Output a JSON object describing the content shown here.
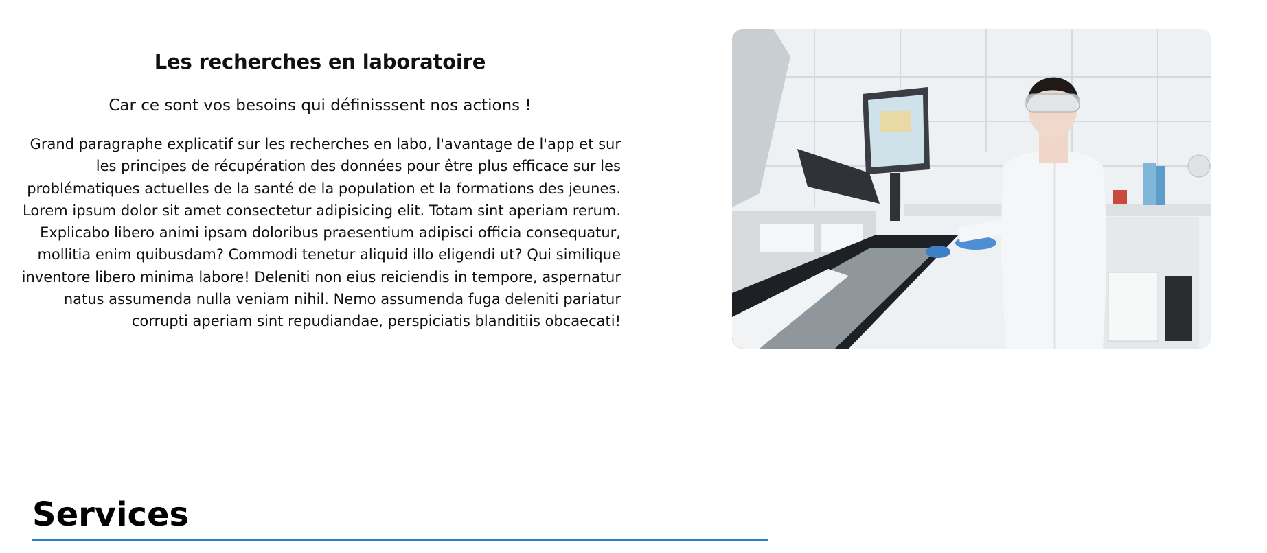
{
  "lab_section": {
    "title": "Les recherches en laboratoire",
    "subtitle": "Car ce sont vos besoins qui définisssent nos actions !",
    "paragraph": "Grand paragraphe explicatif sur les recherches en labo, l'avantage de l'app et sur les principes de récupération des données pour être plus efficace sur les problématiques actuelles de la santé de la population et la formations des jeunes. Lorem ipsum dolor sit amet consectetur adipisicing elit. Totam sint aperiam rerum. Explicabo libero animi ipsam doloribus praesentium adipisci officia consequatur, mollitia enim quibusdam? Commodi tenetur aliquid illo eligendi ut? Qui similique inventore libero minima labore! Deleniti non eius reiciendis in tempore, aspernatur natus assumenda nulla veniam nihil. Nemo assumenda fuga deleniti pariatur corrupti aperiam sint repudiandae, perspiciatis blanditiis obcaecati!",
    "image_icon": "lab-scientist-photo"
  },
  "services": {
    "title": "Services",
    "underline_color": "#2d7fc4"
  }
}
